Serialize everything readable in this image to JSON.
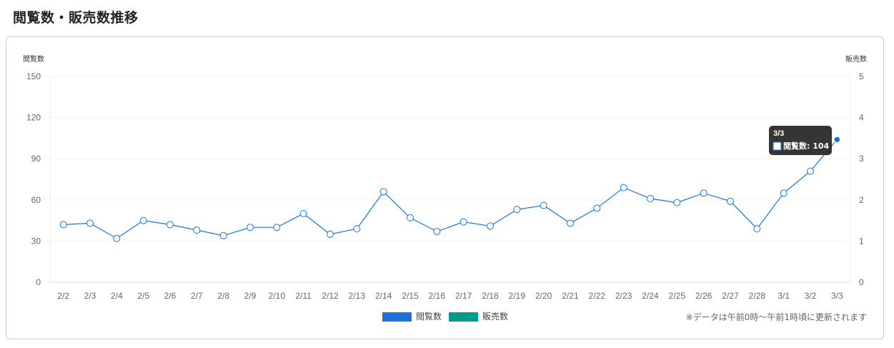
{
  "page": {
    "title": "閲覧数・販売数推移"
  },
  "chart_data": {
    "type": "line",
    "left_axis_title": "閲覧数",
    "right_axis_title": "販売数",
    "categories": [
      "2/2",
      "2/3",
      "2/4",
      "2/5",
      "2/6",
      "2/7",
      "2/8",
      "2/9",
      "2/10",
      "2/11",
      "2/12",
      "2/13",
      "2/14",
      "2/15",
      "2/16",
      "2/17",
      "2/18",
      "2/19",
      "2/20",
      "2/21",
      "2/22",
      "2/23",
      "2/24",
      "2/25",
      "2/26",
      "2/27",
      "2/28",
      "3/1",
      "3/2",
      "3/3"
    ],
    "series": [
      {
        "name": "閲覧数",
        "axis": "left",
        "color": "#1a73d9",
        "values": [
          42,
          43,
          32,
          45,
          42,
          38,
          34,
          40,
          40,
          50,
          35,
          39,
          66,
          47,
          37,
          44,
          41,
          53,
          56,
          43,
          54,
          69,
          61,
          58,
          65,
          59,
          39,
          65,
          81,
          104
        ]
      },
      {
        "name": "販売数",
        "axis": "right",
        "color": "#009e8a",
        "values": []
      }
    ],
    "ylim_left": [
      0,
      150
    ],
    "yticks_left": [
      "0",
      "30",
      "60",
      "90",
      "120",
      "150"
    ],
    "ylim_right": [
      0,
      5
    ],
    "yticks_right": [
      "0",
      "1",
      "2",
      "3",
      "4",
      "5"
    ],
    "grid": true,
    "legend_position": "bottom-center",
    "tooltip": {
      "title": "3/3",
      "label": "閲覧数: 104"
    },
    "note": "※データは午前0時～午前1時頃に更新されます"
  }
}
